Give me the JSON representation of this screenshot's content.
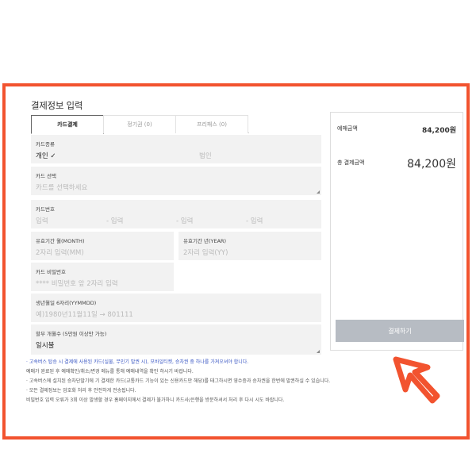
{
  "page": {
    "title": "결제정보 입력",
    "tabs": [
      {
        "label": "카드결제"
      },
      {
        "label": "정기권 (0)"
      },
      {
        "label": "프리패스 (0)"
      }
    ]
  },
  "form": {
    "card_type": {
      "label": "카드종류",
      "option_personal": "개인 ✓",
      "option_corporate": "법인"
    },
    "card_select": {
      "label": "카드 선택",
      "placeholder": "카드를 선택하세요"
    },
    "card_number": {
      "label": "카드번호",
      "parts": [
        "입력",
        "- 입력",
        "- 입력",
        "- 입력"
      ]
    },
    "expiry_month": {
      "label": "유효기간 월(MONTH)",
      "placeholder": "2자리 입력(MM)"
    },
    "expiry_year": {
      "label": "유효기간 년(YEAR)",
      "placeholder": "2자리 입력(YY)"
    },
    "password": {
      "label": "카드 비밀번호",
      "placeholder": "**** 비밀번호 앞 2자리 입력"
    },
    "birth": {
      "label": "생년월일 6자리(YYMMDD)",
      "placeholder": "예)1980년11월11일 → 801111"
    },
    "installment": {
      "label": "할부 개월수 (5만원 이상만 가능)",
      "value": "일시불"
    }
  },
  "summary": {
    "booking_label": "예매금액",
    "booking_amount": "84,200원",
    "total_label": "총 결제금액",
    "total_amount": "84,200원",
    "pay_button": "결제하기"
  },
  "notes": [
    "· 고속버스 탑승 시 결제에 사용된 카드(실물, 무인기 발권 시), 모바일티켓, 승차권 중 하나를 가져오셔야 합니다.",
    "  예매가 완료된 후 예매확인/취소/변경 메뉴를 통해 예매내역을 확인 하시기 바랍니다.",
    "· 고속버스에 설치된 승차단말기에 기 결제한 카드(교통카드 기능이 있는 신용카드만 해당)를 태그하시면 영수증과 승차권을 한번에 발권하실 수 있습니다.",
    "· 모든 결제정보는 암호화 처리 후 안전하게 전송됩니다.",
    "  비밀번호 입력 오류가 3회 이상 발생할 경우 홈페이지에서 결제가 불가하니 카드사/은행을 방문하셔서 처리 후 다시 시도 바랍니다."
  ],
  "colors": {
    "frame": "#f2532f",
    "field_bg": "#f2f2f2",
    "button": "#b7bcc3",
    "note_blue": "#3a57c4"
  }
}
